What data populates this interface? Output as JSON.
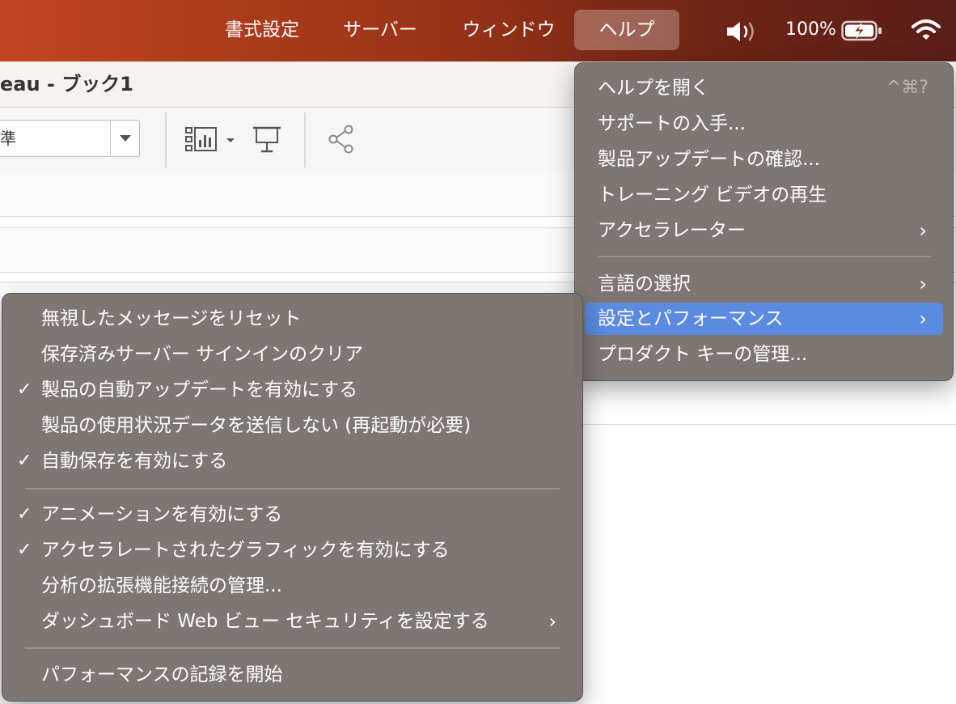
{
  "menubar": {
    "items": [
      "書式設定",
      "サーバー",
      "ウィンドウ",
      "ヘルプ"
    ],
    "battery_percent": "100%"
  },
  "window": {
    "title": "eau - ブック1",
    "combo_value": "準"
  },
  "help_menu": {
    "items": [
      {
        "label": "ヘルプを開く",
        "shortcut": "^⌘?"
      },
      {
        "label": "サポートの入手..."
      },
      {
        "label": "製品アップデートの確認..."
      },
      {
        "label": "トレーニング ビデオの再生"
      },
      {
        "label": "アクセラレーター",
        "submenu": true
      },
      {
        "label": "言語の選択",
        "submenu": true
      },
      {
        "label": "設定とパフォーマンス",
        "submenu": true,
        "highlighted": true
      },
      {
        "label": "プロダクト キーの管理..."
      }
    ]
  },
  "settings_submenu": {
    "items": [
      {
        "label": "無視したメッセージをリセット",
        "checked": false
      },
      {
        "label": "保存済みサーバー サインインのクリア",
        "checked": false
      },
      {
        "label": "製品の自動アップデートを有効にする",
        "checked": true
      },
      {
        "label": "製品の使用状況データを送信しない (再起動が必要)",
        "checked": false
      },
      {
        "label": "自動保存を有効にする",
        "checked": true
      },
      {
        "label": "アニメーションを有効にする",
        "checked": true
      },
      {
        "label": "アクセラレートされたグラフィックを有効にする",
        "checked": true
      },
      {
        "label": "分析の拡張機能接続の管理...",
        "checked": false
      },
      {
        "label": "ダッシュボード Web ビュー セキュリティを設定する",
        "checked": false,
        "submenu": true
      },
      {
        "label": "パフォーマンスの記録を開始",
        "checked": false
      }
    ]
  },
  "glyphs": {
    "chevron": "›",
    "check": "✓"
  }
}
